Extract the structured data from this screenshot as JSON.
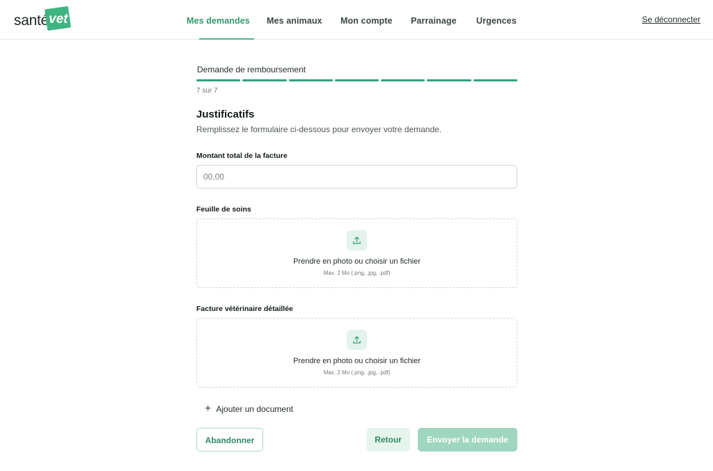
{
  "brand": {
    "part1": "santé",
    "part2": "vet"
  },
  "nav": {
    "items": [
      {
        "label": "Mes demandes"
      },
      {
        "label": "Mes animaux"
      },
      {
        "label": "Mon compte"
      },
      {
        "label": "Parrainage"
      },
      {
        "label": "Urgences"
      }
    ],
    "active_index": 0,
    "logout": "Se déconnecter"
  },
  "colors": {
    "accent": "#2fa275",
    "accent_light": "#e3f3ec",
    "disabled_button": "#9fd6bf"
  },
  "progress": {
    "title": "Demande de remboursement",
    "current": 7,
    "total": 7,
    "count_text": "7 sur 7"
  },
  "form": {
    "title": "Justificatifs",
    "subtitle": "Remplissez le formulaire ci-dessous pour envoyer votre demande.",
    "amount": {
      "label": "Montant total de la facture",
      "placeholder": "00,00",
      "value": ""
    },
    "uploads": [
      {
        "label": "Feuille de soins",
        "action": "Prendre en photo ou choisir un fichier",
        "hint": "Max. 2 Mo (.png, .jpg, .pdf)",
        "icon": "upload-icon"
      },
      {
        "label": "Facture vétérinaire détaillée",
        "action": "Prendre en photo ou choisir un fichier",
        "hint": "Max. 2 Mo (.png, .jpg, .pdf)",
        "icon": "upload-icon"
      }
    ],
    "add_document": "Ajouter un document",
    "buttons": {
      "abandon": "Abandonner",
      "back": "Retour",
      "send": "Envoyer la demande"
    }
  }
}
